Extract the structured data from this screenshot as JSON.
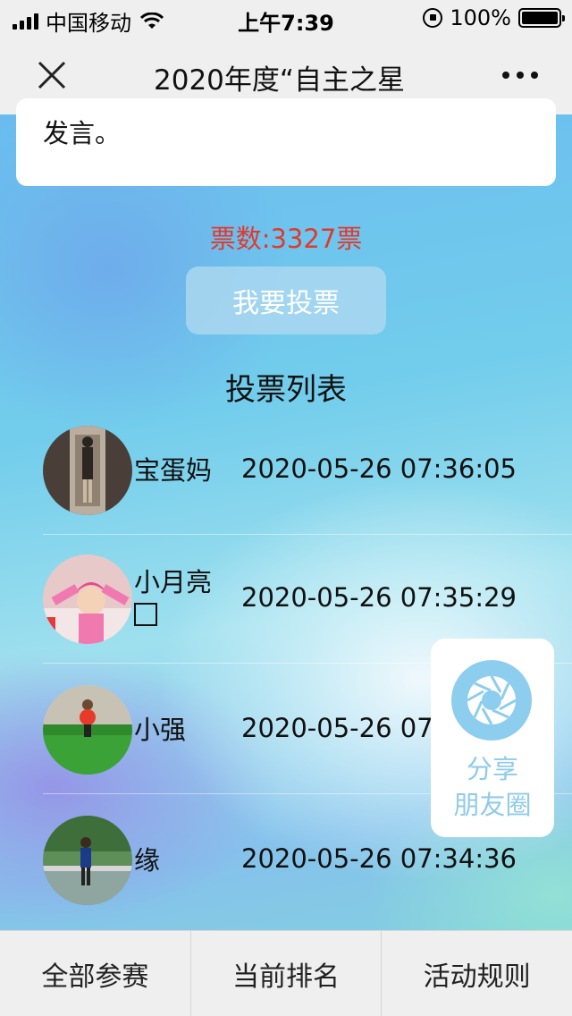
{
  "status_bar": {
    "carrier": "中国移动",
    "time": "上午7:39",
    "battery": "100%"
  },
  "nav": {
    "title": "2020年度“自主之星"
  },
  "card": {
    "text": "发言。"
  },
  "votes_text": "票数:3327票",
  "vote_button": "我要投票",
  "list_title": "投票列表",
  "voters": [
    {
      "name": "宝蛋妈",
      "time": "2020-05-26 07:36:05"
    },
    {
      "name": "小月亮",
      "time": "2020-05-26 07:35:29"
    },
    {
      "name": "小强",
      "time": "2020-05-26 07"
    },
    {
      "name": "缘",
      "time": "2020-05-26 07:34:36"
    }
  ],
  "share": {
    "label_line1": "分享",
    "label_line2": "朋友圈"
  },
  "tabs": [
    {
      "label": "全部参赛"
    },
    {
      "label": "当前排名"
    },
    {
      "label": "活动规则"
    }
  ],
  "colors": {
    "votes_red": "#e03a2c",
    "share_blue": "#8dcdee",
    "bar_gray": "#efefef"
  }
}
